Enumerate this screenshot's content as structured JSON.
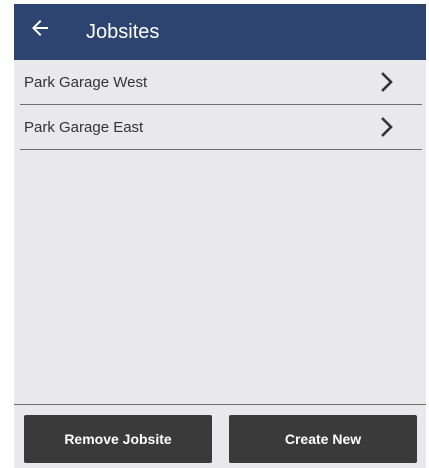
{
  "appbar": {
    "title": "Jobsites",
    "back_icon": "arrow-left-icon",
    "background": "#2e4470"
  },
  "jobsites": [
    {
      "label": "Park Garage West",
      "icon": "chevron-right-icon"
    },
    {
      "label": "Park Garage East",
      "icon": "chevron-right-icon"
    }
  ],
  "footer": {
    "remove_label": "Remove Jobsite",
    "create_label": "Create New",
    "button_color": "#3a3a3a"
  }
}
